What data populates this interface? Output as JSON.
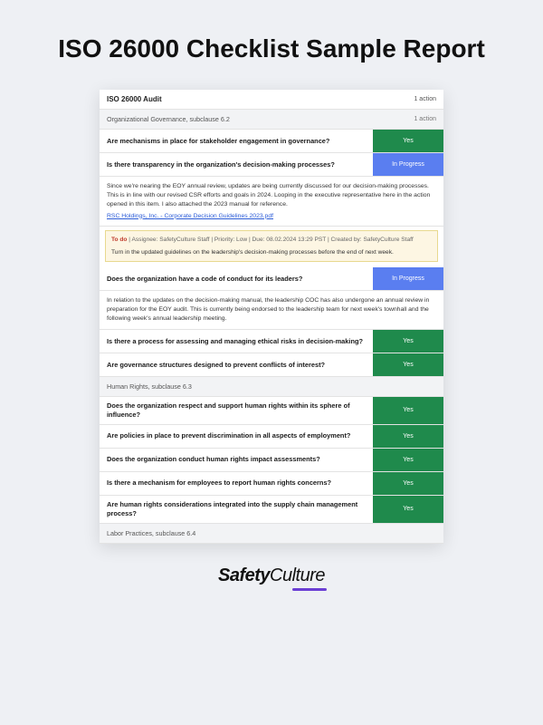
{
  "title": "ISO 26000 Checklist Sample Report",
  "report": {
    "audit_title": "ISO 26000 Audit",
    "audit_action_count": "1 action",
    "sections": [
      {
        "title": "Organizational Governance, subclause 6.2",
        "action_count": "1 action",
        "items": [
          {
            "q": "Are mechanisms in place for stakeholder engagement in governance?",
            "tag": "Yes",
            "tag_type": "yes"
          },
          {
            "q": "Is there transparency in the organization's decision-making processes?",
            "tag": "In Progress",
            "tag_type": "progress",
            "note": "Since we're nearing the EOY annual review, updates are being currently discussed for our decision-making processes. This is in line with our revised CSR efforts and goals in 2024. Looping in the executive representative here in the action opened in this item. I also attached the 2023 manual for reference.",
            "attachment": "RSC Holdings, Inc. - Corporate Decision Guidelines 2023.pdf",
            "todo": {
              "label": "To do",
              "meta": "|  Assignee: SafetyCulture Staff  |  Priority: Low  |  Due: 08.02.2024 13:29 PST  |  Created by: SafetyCulture Staff",
              "task": "Turn in the updated guidelines on the leadership's decision-making processes before the end of next week."
            }
          },
          {
            "q": "Does the organization have a code of conduct for its leaders?",
            "tag": "In Progress",
            "tag_type": "progress",
            "note": "In relation to the updates on the decision-making manual, the leadership COC has also undergone an annual review in preparation for the EOY audit. This is currently being endorsed to the leadership team for next week's townhall and the following week's annual leadership meeting."
          },
          {
            "q": "Is there a process for assessing and managing ethical risks in decision-making?",
            "tag": "Yes",
            "tag_type": "yes"
          },
          {
            "q": "Are governance structures designed to prevent conflicts of interest?",
            "tag": "Yes",
            "tag_type": "yes"
          }
        ]
      },
      {
        "title": "Human Rights, subclause 6.3",
        "action_count": "",
        "items": [
          {
            "q": "Does the organization respect and support human rights within its sphere of influence?",
            "tag": "Yes",
            "tag_type": "yes"
          },
          {
            "q": "Are policies in place to prevent discrimination in all aspects of employment?",
            "tag": "Yes",
            "tag_type": "yes"
          },
          {
            "q": "Does the organization conduct human rights impact assessments?",
            "tag": "Yes",
            "tag_type": "yes"
          },
          {
            "q": "Is there a mechanism for employees to report human rights concerns?",
            "tag": "Yes",
            "tag_type": "yes"
          },
          {
            "q": "Are human rights considerations integrated into the supply chain management process?",
            "tag": "Yes",
            "tag_type": "yes"
          }
        ]
      },
      {
        "title": "Labor Practices, subclause 6.4",
        "action_count": "",
        "items": []
      }
    ]
  },
  "brand": {
    "part1": "Safety",
    "part2": "Culture"
  }
}
